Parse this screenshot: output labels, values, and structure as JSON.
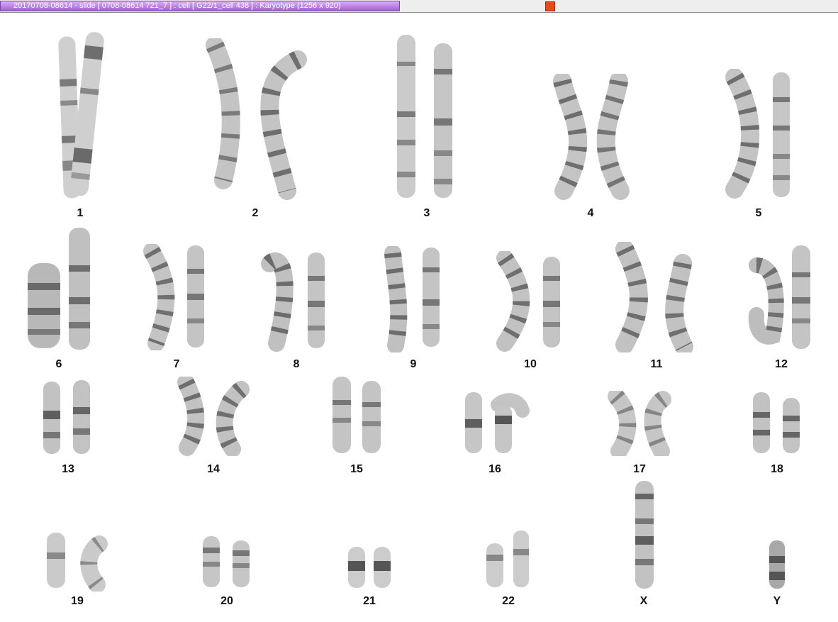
{
  "window": {
    "title": "20170708-08614 - slide [ 0708-08614 721_7 ] : cell [ G22/1_cell 438 ] : Karyotype  (1256 x 920)",
    "marker_color": "#f04a14",
    "accent_color": "#b377e3"
  },
  "karyotype": {
    "chromosomes": [
      {
        "label": "1"
      },
      {
        "label": "2"
      },
      {
        "label": "3"
      },
      {
        "label": "4"
      },
      {
        "label": "5"
      },
      {
        "label": "6"
      },
      {
        "label": "7"
      },
      {
        "label": "8"
      },
      {
        "label": "9"
      },
      {
        "label": "10"
      },
      {
        "label": "11"
      },
      {
        "label": "12"
      },
      {
        "label": "13"
      },
      {
        "label": "14"
      },
      {
        "label": "15"
      },
      {
        "label": "16"
      },
      {
        "label": "17"
      },
      {
        "label": "18"
      },
      {
        "label": "19"
      },
      {
        "label": "20"
      },
      {
        "label": "21"
      },
      {
        "label": "22"
      },
      {
        "label": "X"
      },
      {
        "label": "Y"
      }
    ]
  }
}
